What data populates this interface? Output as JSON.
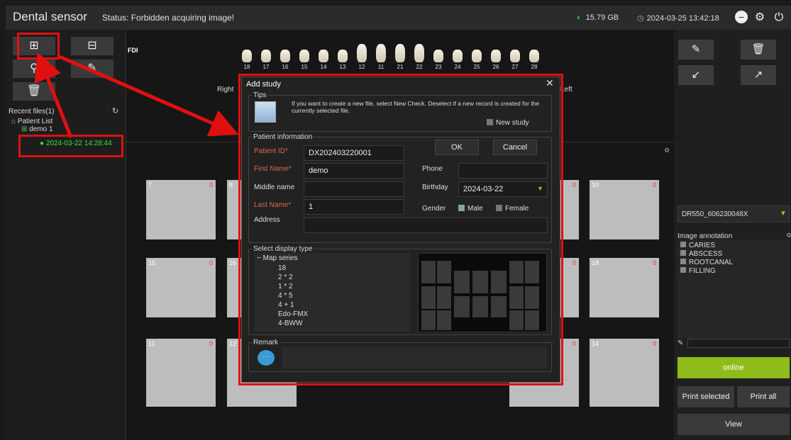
{
  "app": {
    "title": "Dental sensor",
    "status": "Status: Forbidden acquiring image!",
    "disk": "15.79 GB",
    "datetime": "2024-03-25 13:42:18"
  },
  "left": {
    "recent_label": "Recent files(1)",
    "tree": {
      "root": "Patient List",
      "patient": "demo 1",
      "study": "2024-03-22 14:28:44"
    }
  },
  "main": {
    "fdi_label": "FDI",
    "right_label": "Right",
    "left_label": "Left",
    "upper_teeth": [
      "18",
      "17",
      "16",
      "15",
      "14",
      "13",
      "12",
      "11",
      "21",
      "22",
      "23",
      "24",
      "25",
      "26",
      "27",
      "28"
    ],
    "slots_row1": [
      {
        "n": "7",
        "c": "0"
      },
      {
        "n": "8",
        "c": ""
      },
      {
        "n": "",
        "c": "0"
      },
      {
        "n": "10",
        "c": "0"
      }
    ],
    "slots_row2": [
      {
        "n": "15",
        "c": "0"
      },
      {
        "n": "16",
        "c": ""
      },
      {
        "n": "",
        "c": "0"
      },
      {
        "n": "18",
        "c": "0"
      }
    ],
    "slots_row3": [
      {
        "n": "11",
        "c": "0"
      },
      {
        "n": "12",
        "c": ""
      },
      {
        "n": "",
        "c": "0"
      },
      {
        "n": "14",
        "c": "0"
      }
    ]
  },
  "right": {
    "device": "DR550_606230048X",
    "annotation_title": "Image annotation",
    "annotations": [
      "CARIES",
      "ABSCESS",
      "ROOTCANAL",
      "FILLING"
    ],
    "online_label": "online",
    "print_selected": "Print selected",
    "print_all": "Print all",
    "view": "View"
  },
  "dialog": {
    "title": "Add study",
    "tips_title": "Tips",
    "tips_text": "If you want to create a new file, select New Check. Deselect if a new record is created for the currently selected file.",
    "new_study": "New study",
    "patient_info_title": "Patient information",
    "patient_id_label": "Patient ID*",
    "patient_id": "DX202403220001",
    "first_name_label": "First Name*",
    "first_name": "demo",
    "middle_name_label": "Middle name",
    "middle_name": "",
    "last_name_label": "Last Name*",
    "last_name": "1",
    "address_label": "Address",
    "address": "",
    "ok": "OK",
    "cancel": "Cancel",
    "phone_label": "Phone",
    "phone": "",
    "birthday_label": "Birthday",
    "birthday": "2024-03-22",
    "gender_label": "Gender",
    "male": "Male",
    "female": "Female",
    "display_type_title": "Select display type",
    "map_series": "Map series",
    "map_items": [
      "18",
      "2 * 2",
      "1 * 2",
      "4 * 5",
      "4 + 1",
      "Edo-FMX",
      "4-BWW"
    ],
    "remark_title": "Remark"
  }
}
